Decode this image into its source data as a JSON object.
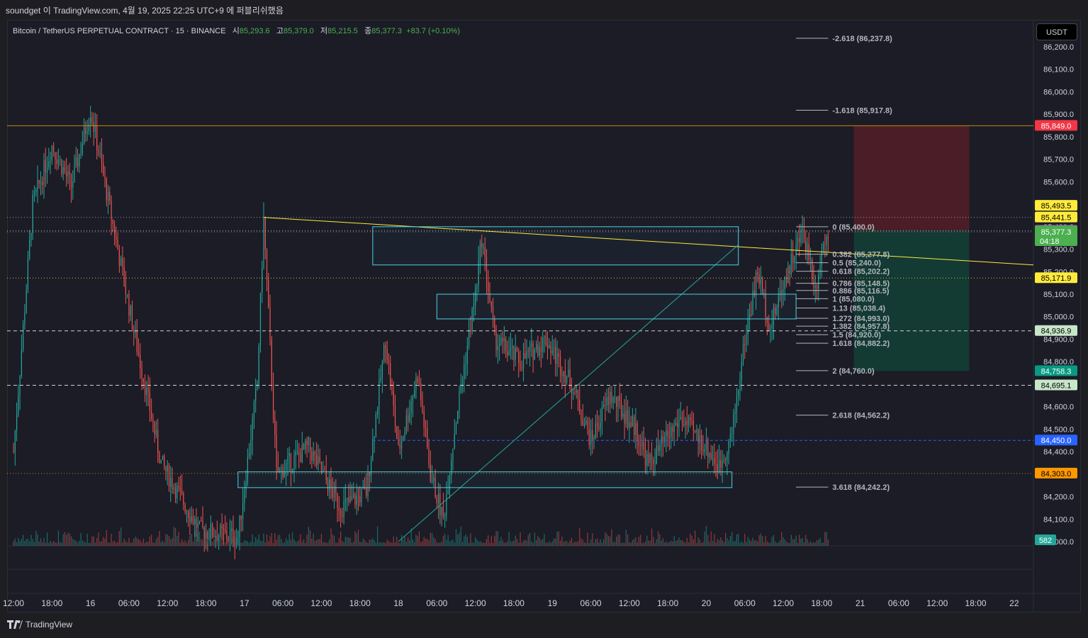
{
  "publisher_line": "soundget 이 TradingView.com, 4월 19, 2025 22:25 UTC+9 에 퍼블리쉬했음",
  "legend": {
    "symbol": "Bitcoin / TetherUS PERPETUAL CONTRACT · 15 · BINANCE",
    "open_label": "시",
    "open": "85,293.6",
    "high_label": "고",
    "high": "85,379.0",
    "low_label": "저",
    "low": "85,215.5",
    "close_label": "종",
    "close": "85,377.3",
    "change": "+83.7 (+0.10%)"
  },
  "currency_button": "USDT",
  "brand": "TradingView",
  "colors": {
    "background": "#1b1c26",
    "up_candle": "#26a69a",
    "down_candle": "#ef5350",
    "fib": "#b2b5be",
    "trendline": "#ffeb3b",
    "rectangle": "#4dd0e1",
    "stop_zone": "#5c1f28",
    "target_zone": "#124036"
  },
  "chart_data": {
    "type": "candlestick",
    "symbol": "BTCUSDT.P",
    "interval": "15",
    "ylim": [
      83900,
      86300
    ],
    "y_ticks": [
      84000,
      84100,
      84200,
      84300,
      84400,
      84500,
      84600,
      84700,
      84800,
      84900,
      85000,
      85100,
      85200,
      85300,
      85400,
      85500,
      85600,
      85700,
      85800,
      85900,
      86000,
      86100,
      86200
    ],
    "y_tick_labels": [
      "84,000.0",
      "84,100.0",
      "84,200.0",
      "84,300.0",
      "84,400.0",
      "84,500.0",
      "84,600.0",
      "84,700.0",
      "84,800.0",
      "84,900.0",
      "85,000.0",
      "85,100.0",
      "85,200.0",
      "85,300.0",
      "85,400.0",
      "85,500.0",
      "85,600.0",
      "85,700.0",
      "85,800.0",
      "85,900.0",
      "86,000.0",
      "86,100.0",
      "86,200.0"
    ],
    "x_tick_labels": [
      "12:00",
      "18:00",
      "16",
      "06:00",
      "12:00",
      "18:00",
      "17",
      "06:00",
      "12:00",
      "18:00",
      "18",
      "06:00",
      "12:00",
      "18:00",
      "19",
      "06:00",
      "12:00",
      "18:00",
      "20",
      "06:00",
      "12:00",
      "18:00",
      "21",
      "06:00",
      "12:00",
      "18:00",
      "22"
    ],
    "x_range_hours": [
      -37,
      123
    ],
    "price_path": [
      {
        "t": -36,
        "p": 84400
      },
      {
        "t": -33,
        "p": 85500
      },
      {
        "t": -30,
        "p": 85760
      },
      {
        "t": -27,
        "p": 85580
      },
      {
        "t": -24,
        "p": 85920
      },
      {
        "t": -21,
        "p": 85480
      },
      {
        "t": -17,
        "p": 84900
      },
      {
        "t": -13,
        "p": 84350
      },
      {
        "t": -7,
        "p": 84050
      },
      {
        "t": -1,
        "p": 84020
      },
      {
        "t": 2,
        "p": 84700
      },
      {
        "t": 3,
        "p": 85430
      },
      {
        "t": 5,
        "p": 84300
      },
      {
        "t": 10,
        "p": 84420
      },
      {
        "t": 15,
        "p": 84150
      },
      {
        "t": 19,
        "p": 84220
      },
      {
        "t": 22,
        "p": 84900
      },
      {
        "t": 24,
        "p": 84400
      },
      {
        "t": 27,
        "p": 84740
      },
      {
        "t": 29,
        "p": 84300
      },
      {
        "t": 31,
        "p": 84100
      },
      {
        "t": 33,
        "p": 84550
      },
      {
        "t": 36,
        "p": 85100
      },
      {
        "t": 37,
        "p": 85350
      },
      {
        "t": 39,
        "p": 84900
      },
      {
        "t": 43,
        "p": 84800
      },
      {
        "t": 47,
        "p": 84900
      },
      {
        "t": 51,
        "p": 84700
      },
      {
        "t": 54,
        "p": 84450
      },
      {
        "t": 57,
        "p": 84650
      },
      {
        "t": 61,
        "p": 84500
      },
      {
        "t": 63,
        "p": 84340
      },
      {
        "t": 68,
        "p": 84550
      },
      {
        "t": 72,
        "p": 84420
      },
      {
        "t": 74,
        "p": 84330
      },
      {
        "t": 76,
        "p": 84480
      },
      {
        "t": 78,
        "p": 84900
      },
      {
        "t": 80,
        "p": 85200
      },
      {
        "t": 82,
        "p": 84950
      },
      {
        "t": 84,
        "p": 85150
      },
      {
        "t": 87,
        "p": 85380
      },
      {
        "t": 88,
        "p": 85280
      },
      {
        "t": 89,
        "p": 85120
      },
      {
        "t": 90,
        "p": 85300
      },
      {
        "t": 91,
        "p": 85377
      }
    ],
    "volume": {
      "last_label": "582"
    },
    "horizontal_lines": [
      {
        "price": 85849.0,
        "style": "solid",
        "color": "#f0a000"
      },
      {
        "price": 85441.5,
        "style": "dotted",
        "color": "#b2b5be"
      },
      {
        "price": 85382.3,
        "style": "dotted",
        "color": "#b2b5be"
      },
      {
        "price": 85377.3,
        "style": "dotted",
        "color": "#b2b5be"
      },
      {
        "price": 85171.9,
        "style": "dotted",
        "color": "#ffeb3b"
      },
      {
        "price": 84936.9,
        "style": "dashed",
        "color": "#ffffff"
      },
      {
        "price": 84695.1,
        "style": "dashed",
        "color": "#ffffff"
      },
      {
        "price": 84303.0,
        "style": "dotted",
        "color": "#f0a000"
      }
    ],
    "price_badges": [
      {
        "label": "85,849.0",
        "price": 85849.0,
        "bg": "#f23645",
        "fg": "#ffffff"
      },
      {
        "label": "85,493.5",
        "price": 85493.5,
        "bg": "#ffeb3b",
        "fg": "#000000"
      },
      {
        "label": "85,441.5",
        "price": 85441.5,
        "bg": "#ffeb3b",
        "fg": "#000000"
      },
      {
        "label": "85,382.3",
        "price": 85382.3,
        "bg": "#787b86",
        "fg": "#ffffff"
      },
      {
        "label": "85,377.3",
        "price": 85377.3,
        "bg": "#4caf50",
        "fg": "#ffffff",
        "sub": "04:18"
      },
      {
        "label": "85,171.9",
        "price": 85171.9,
        "bg": "#ffeb3b",
        "fg": "#000000"
      },
      {
        "label": "84,936.9",
        "price": 84936.9,
        "bg": "#c8e6c9",
        "fg": "#000000"
      },
      {
        "label": "84,758.3",
        "price": 84758.3,
        "bg": "#089981",
        "fg": "#ffffff"
      },
      {
        "label": "84,695.1",
        "price": 84695.1,
        "bg": "#c8e6c9",
        "fg": "#000000"
      },
      {
        "label": "84,450.0",
        "price": 84450.0,
        "bg": "#2962ff",
        "fg": "#ffffff"
      },
      {
        "label": "84,303.0",
        "price": 84303.0,
        "bg": "#ff9800",
        "fg": "#000000"
      }
    ],
    "fibonacci": [
      {
        "label": "-2.618 (86,237.8)",
        "price": 86237.8
      },
      {
        "label": "-1.618 (85,917.8)",
        "price": 85917.8
      },
      {
        "label": "0 (85,400.0)",
        "price": 85400.0
      },
      {
        "label": "0.382 (85,277.8)",
        "price": 85277.8
      },
      {
        "label": "0.5 (85,240.0)",
        "price": 85240.0
      },
      {
        "label": "0.618 (85,202.2)",
        "price": 85202.2
      },
      {
        "label": "0.786 (85,148.5)",
        "price": 85148.5
      },
      {
        "label": "0.886 (85,116.5)",
        "price": 85116.5
      },
      {
        "label": "1 (85,080.0)",
        "price": 85080.0
      },
      {
        "label": "1.13 (85,038.4)",
        "price": 85038.4
      },
      {
        "label": "1.272 (84,993.0)",
        "price": 84993.0
      },
      {
        "label": "1.382 (84,957.8)",
        "price": 84957.8
      },
      {
        "label": "1.5 (84,920.0)",
        "price": 84920.0
      },
      {
        "label": "1.618 (84,882.2)",
        "price": 84882.2
      },
      {
        "label": "2 (84,760.0)",
        "price": 84760.0
      },
      {
        "label": "2.618 (84,562.2)",
        "price": 84562.2
      },
      {
        "label": "3.618 (84,242.2)",
        "price": 84242.2
      }
    ],
    "fib_time_range": [
      86,
      91
    ],
    "trendlines": [
      {
        "t1": 3,
        "p1": 85441.5,
        "t2": 123,
        "p2": 85230,
        "color": "#ffeb3b"
      },
      {
        "t1": 24,
        "p1": 84000,
        "t2": 77,
        "p2": 85320,
        "color": "#26a69a"
      }
    ],
    "rectangles": [
      {
        "t1": 20,
        "p1": 85400,
        "t2": 77,
        "p2": 85230
      },
      {
        "t1": 30,
        "p1": 85100,
        "t2": 86,
        "p2": 84990
      },
      {
        "t1": -1,
        "p1": 84310,
        "t2": 76,
        "p2": 84240
      }
    ],
    "dashed_segment": {
      "t1": 20,
      "price": 84450.0
    },
    "position_tool": {
      "t1": 95,
      "t2": 113,
      "entry": 85382.3,
      "stop": 85849.0,
      "target": 84758.3
    }
  }
}
